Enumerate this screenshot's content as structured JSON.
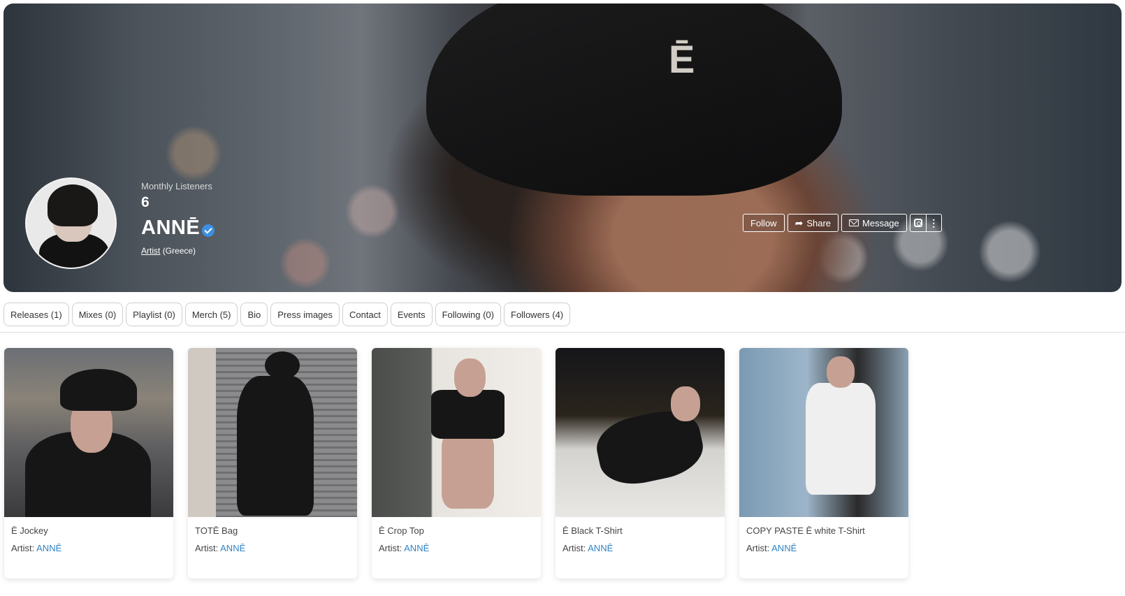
{
  "hero": {
    "cap_logo": "Ē",
    "listeners_label": "Monthly Listeners",
    "listeners_value": "6",
    "artist_name": "ANNĒ",
    "artist_type_link": "Artist",
    "artist_location": "(Greece)",
    "actions": {
      "follow": "Follow",
      "share": "Share",
      "message": "Message"
    }
  },
  "tabs": [
    {
      "label": "Releases (1)"
    },
    {
      "label": "Mixes (0)"
    },
    {
      "label": "Playlist (0)"
    },
    {
      "label": "Merch (5)"
    },
    {
      "label": "Bio"
    },
    {
      "label": "Press images"
    },
    {
      "label": "Contact"
    },
    {
      "label": "Events"
    },
    {
      "label": "Following (0)"
    },
    {
      "label": "Followers (4)"
    }
  ],
  "merch": [
    {
      "title": "Ē Jockey",
      "artist_label": "Artist:",
      "artist": "ANNĒ"
    },
    {
      "title": "TOTĒ Bag",
      "artist_label": "Artist:",
      "artist": "ANNĒ"
    },
    {
      "title": "Ē Crop Top",
      "artist_label": "Artist:",
      "artist": "ANNĒ"
    },
    {
      "title": "Ē Black T-Shirt",
      "artist_label": "Artist:",
      "artist": "ANNĒ"
    },
    {
      "title": "COPY PASTE Ē white T-Shirt",
      "artist_label": "Artist:",
      "artist": "ANNĒ"
    }
  ],
  "colors": {
    "accent_link": "#2f84c6",
    "verified": "#3d8fe0"
  }
}
